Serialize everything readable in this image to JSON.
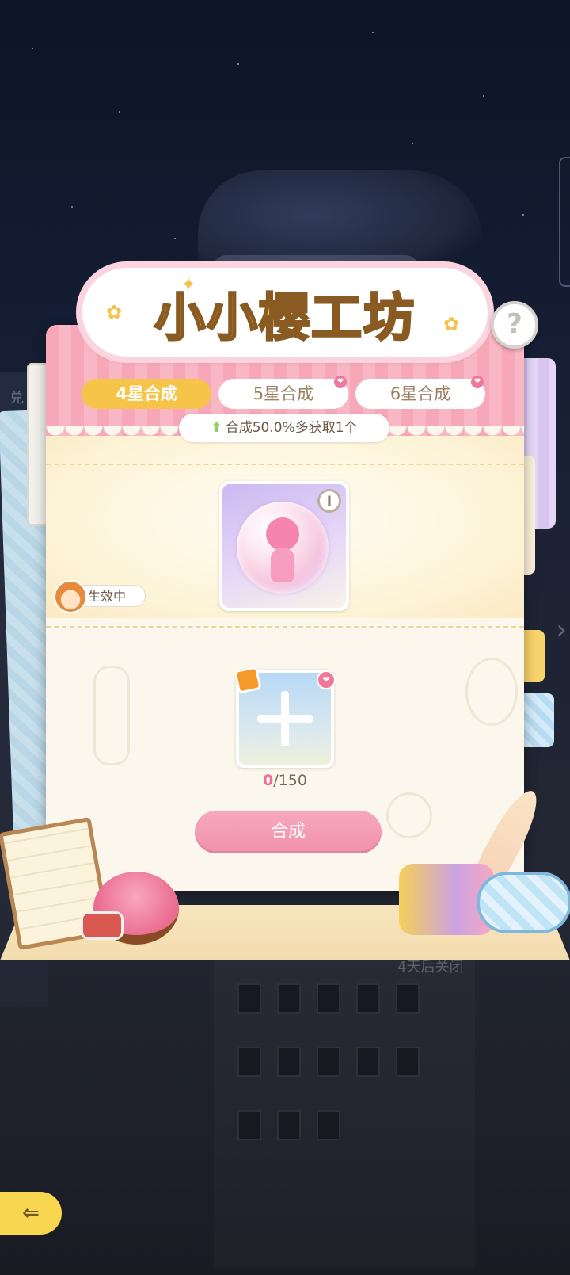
{
  "title": "小小樱工坊",
  "help_label": "?",
  "tabs": [
    {
      "label": "4星合成",
      "active": true,
      "badge": false
    },
    {
      "label": "5星合成",
      "active": false,
      "badge": true
    },
    {
      "label": "6星合成",
      "active": false,
      "badge": true
    }
  ],
  "bonus_text": "合成50.0%多获取1个",
  "background_bonus_text": "合成50.0%多获取1个",
  "background_left_label": "兑",
  "background_footer_text": "4天后关闭",
  "effect_badge_label": "生效中",
  "info_label": "i",
  "material": {
    "have": "0",
    "need": "/150"
  },
  "craft_button_label": "合成",
  "back_icon": "back-arrow-icon",
  "colors": {
    "header_pink": "#f6a7b8",
    "active_tab": "#f7c44a",
    "craft_button": "#f191ab",
    "count_highlight": "#ee6f95",
    "back_button": "#f8d64f"
  }
}
